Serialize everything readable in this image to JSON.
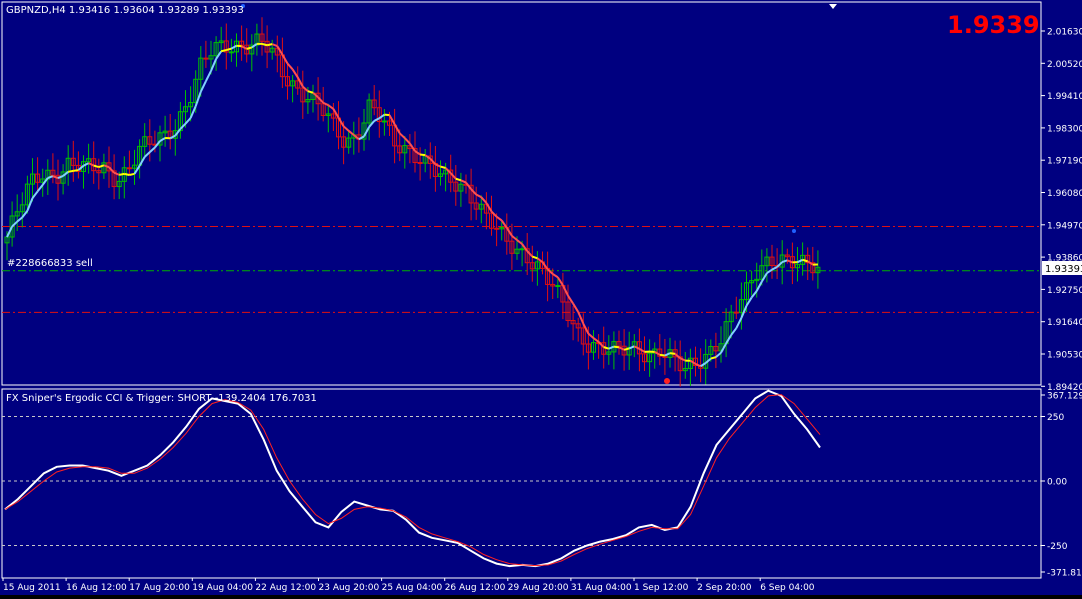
{
  "colors": {
    "background": "#000080",
    "frame": "#FFFFFF",
    "bull_candle": "#00C000",
    "bear_candle": "#E01010",
    "ma_up": "#80D0FF",
    "ma_flat": "#FFFF00",
    "ma_down": "#FF5050",
    "level_red": "#E01010",
    "level_green": "#00B000",
    "cci": "#FFFFFF",
    "trigger": "#FF2020",
    "big_price": "#FF0000",
    "text": "#FFFFFF"
  },
  "header": {
    "symbol_info": "GBPNZD,H4  1.93416 1.93604 1.93289 1.93393",
    "big_price": "1.9339"
  },
  "order_label": "#228666833 sell",
  "current_price_label": "1.93393",
  "indicator": {
    "title": "FX Sniper's Ergodic CCI & Trigger: SHORT -139.2404 176.7031"
  },
  "chart_data": [
    {
      "type": "candlestick",
      "symbol": "GBPNZD",
      "timeframe": "H4",
      "ylim": [
        1.8942,
        2.0218
      ],
      "yticks": [
        "2.01630",
        "2.00520",
        "1.99410",
        "1.98300",
        "1.97190",
        "1.96080",
        "1.94970",
        "1.93860",
        "1.92750",
        "1.91640",
        "1.90530",
        "1.89420"
      ],
      "x_tick_labels": [
        "15 Aug 2011",
        "16 Aug 12:00",
        "17 Aug 20:00",
        "19 Aug 04:00",
        "22 Aug 12:00",
        "23 Aug 20:00",
        "25 Aug 04:00",
        "26 Aug 12:00",
        "29 Aug 20:00",
        "31 Aug 04:00",
        "1 Sep 12:00",
        "2 Sep 20:00",
        "6 Sep 04:00"
      ],
      "ohlc_close_path": [
        1.9455,
        1.955,
        1.964,
        1.968,
        1.967,
        1.97,
        1.969,
        1.969,
        1.97,
        1.966,
        1.968,
        1.975,
        1.978,
        1.981,
        1.985,
        1.992,
        2.003,
        2.01,
        2.012,
        2.012,
        2.011,
        2.012,
        2.008,
        2.001,
        1.997,
        1.993,
        1.989,
        1.983,
        1.978,
        1.982,
        1.991,
        1.985,
        1.977,
        1.976,
        1.974,
        1.97,
        1.965,
        1.963,
        1.962,
        1.957,
        1.951,
        1.944,
        1.94,
        1.939,
        1.936,
        1.93,
        1.921,
        1.912,
        1.909,
        1.909,
        1.907,
        1.906,
        1.906,
        1.905,
        1.908,
        1.904,
        1.899,
        1.901,
        1.906,
        1.912,
        1.92,
        1.925,
        1.933,
        1.938,
        1.939,
        1.937,
        1.935,
        1.934
      ],
      "horizontal_levels": [
        {
          "value": 1.9491,
          "style": "dash-dot",
          "color": "red"
        },
        {
          "value": 1.9339,
          "style": "dash-dot",
          "color": "green",
          "label": "#228666833 sell"
        },
        {
          "value": 1.9196,
          "style": "dash-dot",
          "color": "red"
        }
      ],
      "markers": [
        {
          "index": 60,
          "value": 1.8946,
          "color": "red"
        },
        {
          "index": 189,
          "value": 1.9489,
          "color": "blue"
        }
      ],
      "current_price": 1.93393
    },
    {
      "type": "line",
      "title": "FX Sniper's Ergodic CCI & Trigger: SHORT -139.2404 176.7031",
      "ylim": [
        -371.811,
        367.1293
      ],
      "yticks": [
        "367.1293",
        "250",
        "0.00",
        "-250",
        "-371.811"
      ],
      "reference_lines": [
        250,
        0,
        -250
      ],
      "x_tick_labels": [
        "15 Aug 2011",
        "16 Aug 12:00",
        "17 Aug 20:00",
        "19 Aug 04:00",
        "22 Aug 12:00",
        "23 Aug 20:00",
        "25 Aug 04:00",
        "26 Aug 12:00",
        "29 Aug 20:00",
        "31 Aug 04:00",
        "1 Sep 12:00",
        "2 Sep 20:00",
        "6 Sep 04:00"
      ],
      "series": [
        {
          "name": "SHORT",
          "color": "white",
          "values": [
            -110,
            -70,
            -20,
            30,
            55,
            60,
            60,
            50,
            40,
            20,
            40,
            60,
            100,
            150,
            210,
            280,
            320,
            310,
            300,
            260,
            160,
            40,
            -40,
            -100,
            -160,
            -180,
            -120,
            -80,
            -95,
            -110,
            -115,
            -150,
            -200,
            -220,
            -230,
            -240,
            -270,
            -300,
            -320,
            -330,
            -325,
            -330,
            -320,
            -300,
            -270,
            -250,
            -235,
            -225,
            -210,
            -180,
            -170,
            -190,
            -180,
            -100,
            30,
            140,
            200,
            260,
            320,
            350,
            330,
            260,
            200,
            130
          ]
        },
        {
          "name": "Trigger",
          "color": "red",
          "values": [
            -110,
            -80,
            -40,
            0,
            35,
            50,
            55,
            55,
            50,
            30,
            30,
            50,
            85,
            130,
            185,
            250,
            300,
            315,
            305,
            275,
            200,
            90,
            0,
            -70,
            -130,
            -165,
            -145,
            -110,
            -100,
            -105,
            -115,
            -140,
            -180,
            -205,
            -220,
            -235,
            -255,
            -285,
            -305,
            -320,
            -325,
            -328,
            -325,
            -310,
            -285,
            -262,
            -245,
            -230,
            -215,
            -195,
            -180,
            -185,
            -185,
            -130,
            -20,
            90,
            165,
            225,
            285,
            330,
            335,
            300,
            240,
            180
          ]
        }
      ]
    }
  ]
}
